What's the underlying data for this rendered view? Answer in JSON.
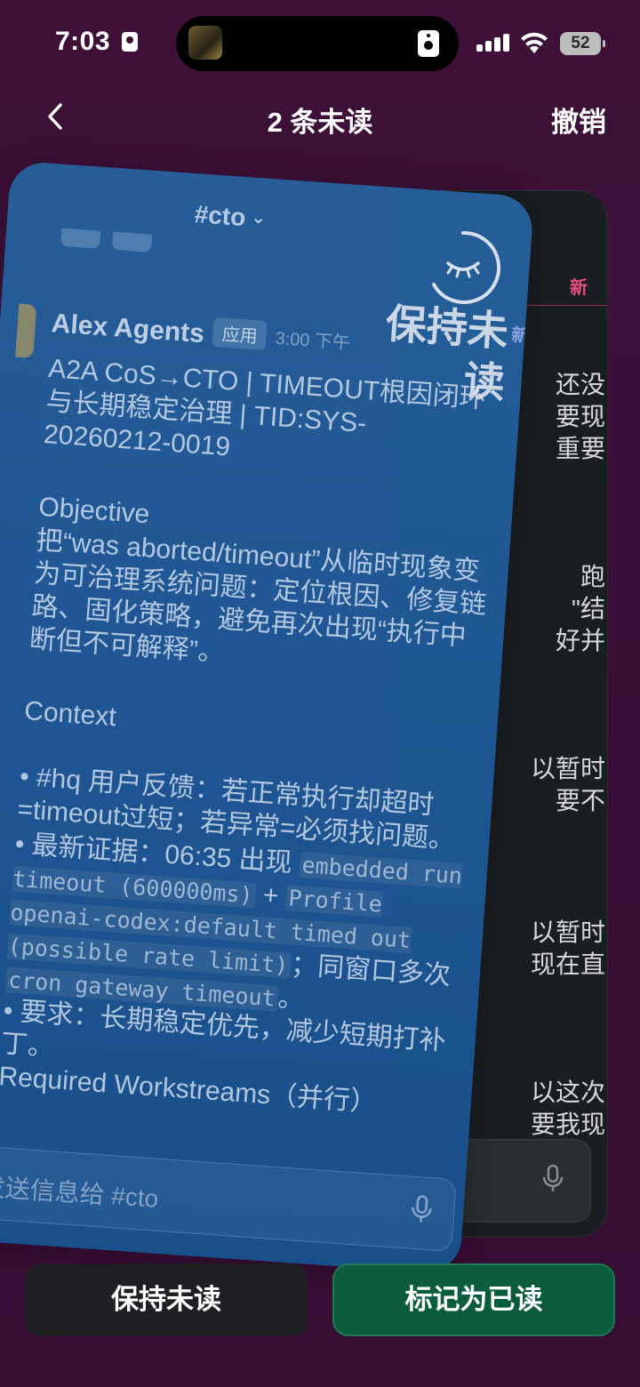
{
  "status_bar": {
    "time": "7:03",
    "battery": "52"
  },
  "nav": {
    "title": "2 条未读",
    "undo": "撤销"
  },
  "back_card": {
    "new_badge": "新",
    "lines": [
      "还没\n要现\n重要",
      "跑\n\"结\n好并",
      "以暂时\n要不",
      "以暂时\n现在直",
      "以这次\n要我现"
    ]
  },
  "front_card": {
    "channel": "#cto",
    "new_tag": "新",
    "sender": "Alex Agents",
    "app_tag": "应用",
    "time": "3:00 下午",
    "subject": "A2A CoS→CTO | TIMEOUT根因闭环与长期稳定治理 | TID:SYS-20260212-0019",
    "objective_heading": "Objective",
    "objective_text": "把“was aborted/timeout”从临时现象变为可治理系统问题：定位根因、修复链路、固化策略，避免再次出现“执行中断但不可解释”。",
    "context_heading": "Context",
    "bullet1": "• #hq 用户反馈：若正常执行却超时=timeout过短；若异常=必须找问题。",
    "bullet2_prefix": "• 最新证据：06:35 出现 ",
    "code1": "embedded run timeout (600000ms)",
    "plus": " + ",
    "code2": "Profile openai-codex:default timed out (possible rate limit)",
    "bullet2_mid": "；同窗口多次 ",
    "code3": "cron gateway timeout",
    "bullet2_end": "。",
    "bullet3": "• 要求：长期稳定优先，减少短期打补丁。",
    "workstreams": "Required Workstreams（并行）",
    "input_placeholder": "发送信息给 #cto"
  },
  "swipe_overlay": {
    "label": "保持未读"
  },
  "actions": {
    "keep_unread": "保持未读",
    "mark_read": "标记为已读"
  }
}
